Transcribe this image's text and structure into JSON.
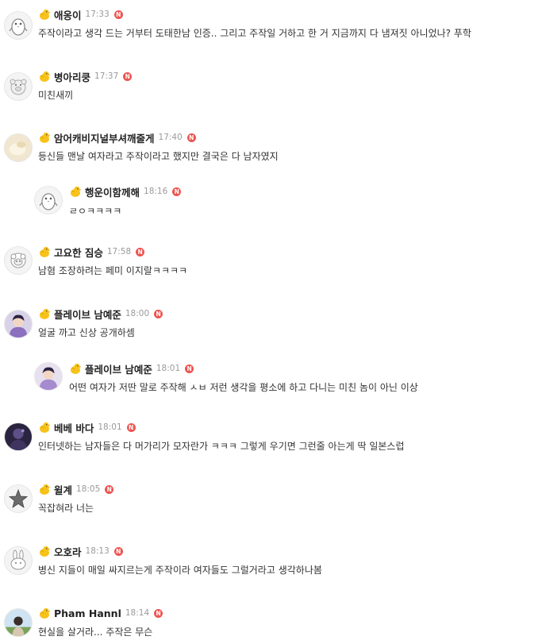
{
  "comments": [
    {
      "nick": "애옹이",
      "time": "17:33",
      "new_badge": "N",
      "text": "주작이라고 생각 드는 거부터 도태한남 인증.. 그리고 주작일 거하고 한 거 지금까지 다 냄져짓 아니었나? 푸학",
      "avatar_icon": "penguin-icon"
    },
    {
      "nick": "병아리쿵",
      "time": "17:37",
      "new_badge": "N",
      "text": "미친새끼",
      "avatar_icon": "pig-icon"
    },
    {
      "nick": "암어캐비지널부셔깨줄게",
      "time": "17:40",
      "new_badge": "N",
      "text": "등신들 맨날 여자라고 주작이라고 했지만 결국은 다 남자였지",
      "avatar_icon": "photo-avatar-icon"
    },
    {
      "nick": "행운이함께해",
      "time": "18:16",
      "new_badge": "N",
      "text": "ㄹㅇㅋㅋㅋㅋ",
      "avatar_icon": "penguin-icon"
    },
    {
      "nick": "고요한 짐승",
      "time": "17:58",
      "new_badge": "N",
      "text": "남혐 조장하려는 페미 이지랄ㅋㅋㅋㅋ",
      "avatar_icon": "sheep-icon"
    },
    {
      "nick": "플레이브 남예준",
      "time": "18:00",
      "new_badge": "N",
      "text": "얼굴 까고 신상 공개하셈",
      "avatar_icon": "photo-avatar-icon"
    },
    {
      "nick": "플레이브 남예준",
      "time": "18:01",
      "new_badge": "N",
      "text": "어떤 여자가 저딴 말로 주작해 ㅅㅂ 저런 생각을 평소에 하고 다니는 미친 놈이 아닌 이상",
      "avatar_icon": "photo-avatar-icon"
    },
    {
      "nick": "베베 바다",
      "time": "18:01",
      "new_badge": "N",
      "text": "인터넷하는 남자들은 다 머가리가 모자란가 ㅋㅋㅋ 그렇게 우기면 그런줄 아는게 딱 일본스럽",
      "avatar_icon": "photo-avatar-icon"
    },
    {
      "nick": "윌계",
      "time": "18:05",
      "new_badge": "N",
      "text": "꼭잡혀라 너는",
      "avatar_icon": "star-icon"
    },
    {
      "nick": "오호라",
      "time": "18:13",
      "new_badge": "N",
      "text": "병신 지들이 매일 싸지르는게 주작이라 여자들도 그럴거라고 생각하나봄",
      "avatar_icon": "rabbit-icon"
    },
    {
      "nick": "Pham Hannl",
      "time": "18:14",
      "new_badge": "N",
      "text": "현실을 살거라... 주작은 무슨",
      "avatar_icon": "photo-avatar-icon"
    }
  ],
  "colors": {
    "new_badge": "#ef5350",
    "chick_badge": "#f5b400",
    "time_text": "#9a9a9a"
  }
}
